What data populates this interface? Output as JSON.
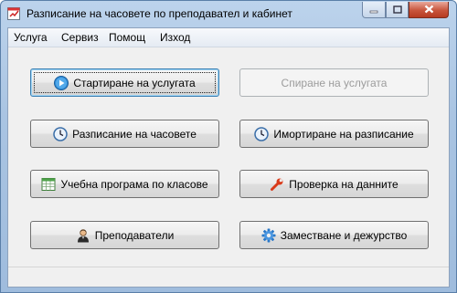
{
  "window": {
    "title": "Разписание на часовете по преподавател и кабинет",
    "icon": "calendar-app-icon",
    "controls": [
      "minimize-icon",
      "maximize-icon",
      "close-icon"
    ]
  },
  "menu": [
    {
      "label": "Услуга"
    },
    {
      "label": "Сервиз"
    },
    {
      "label": "Помощ"
    },
    {
      "label": "Изход"
    }
  ],
  "buttons": {
    "start_service": {
      "label": "Стартиране на услугата",
      "icon": "play-icon",
      "enabled": true,
      "focused": true
    },
    "stop_service": {
      "label": "Спиране на  услугата",
      "icon": "",
      "enabled": false
    },
    "schedule": {
      "label": "Разписание на часовете",
      "icon": "clock-icon",
      "enabled": true
    },
    "import_schedule": {
      "label": "Имортиране на разписание",
      "icon": "clock-icon",
      "enabled": true
    },
    "curriculum": {
      "label": "Учебна програма по класове",
      "icon": "table-icon",
      "enabled": true
    },
    "check_data": {
      "label": "Проверка на данните",
      "icon": "wrench-icon",
      "enabled": true
    },
    "teachers": {
      "label": "Преподаватели",
      "icon": "person-icon",
      "enabled": true
    },
    "substitution": {
      "label": "Заместване и дежурство",
      "icon": "gear-icon",
      "enabled": true
    }
  },
  "colors": {
    "accent": "#3c7fb1",
    "play": "#2f8bd6",
    "wrench": "#d93a1a",
    "gear": "#2a78c8",
    "table": "#4ea24a"
  }
}
